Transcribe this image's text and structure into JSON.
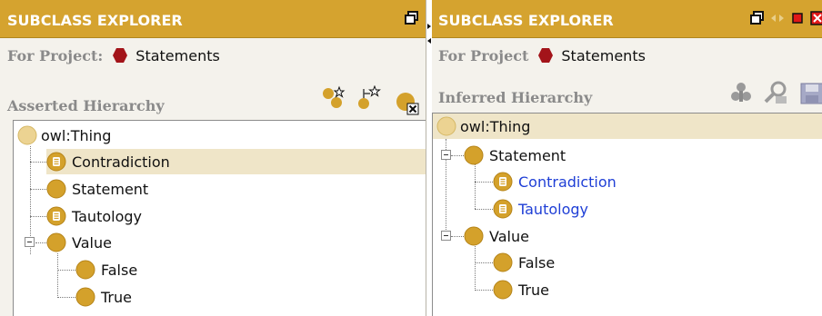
{
  "colors": {
    "title_bar": "#d5a32f",
    "panel_bg": "#f4f2ec",
    "class_icon": "#d4a12b",
    "thing_icon": "#ecd392",
    "selection_bg": "#efe5c8",
    "inferred_text": "#1f3fd6",
    "project_icon": "#a3141a"
  },
  "left": {
    "title": "SUBCLASS EXPLORER",
    "project_label": "For Project:",
    "project_name": "Statements",
    "hierarchy_label": "Asserted Hierarchy",
    "toolbar_icons": [
      "add-subclass-icon",
      "add-sibling-class-icon",
      "delete-class-icon"
    ],
    "window_icons": [
      "maximize-window-icon"
    ],
    "tree": [
      {
        "label": "owl:Thing",
        "icon": "owl-thing-icon",
        "depth": 0
      },
      {
        "label": "Contradiction",
        "icon": "defined-class-icon",
        "depth": 1,
        "selected": true
      },
      {
        "label": "Statement",
        "icon": "class-icon",
        "depth": 1
      },
      {
        "label": "Tautology",
        "icon": "defined-class-icon",
        "depth": 1
      },
      {
        "label": "Value",
        "icon": "class-icon",
        "depth": 1,
        "expanded": true
      },
      {
        "label": "False",
        "icon": "class-icon",
        "depth": 2
      },
      {
        "label": "True",
        "icon": "class-icon",
        "depth": 2
      }
    ]
  },
  "right": {
    "title": "SUBCLASS EXPLORER",
    "project_label": "For Project",
    "project_name": "Statements",
    "hierarchy_label": "Inferred Hierarchy",
    "toolbar_icons": [
      "classify-icon",
      "find-class-icon",
      "save-icon"
    ],
    "window_icons": [
      "maximize-window-icon",
      "arrows-icon",
      "minimize-icon",
      "close-icon"
    ],
    "tree": [
      {
        "label": "owl:Thing",
        "icon": "owl-thing-icon",
        "depth": 0,
        "selected": true
      },
      {
        "label": "Statement",
        "icon": "class-icon",
        "depth": 1,
        "expanded": true
      },
      {
        "label": "Contradiction",
        "icon": "defined-class-icon",
        "depth": 2,
        "inferred": true
      },
      {
        "label": "Tautology",
        "icon": "defined-class-icon",
        "depth": 2,
        "inferred": true
      },
      {
        "label": "Value",
        "icon": "class-icon",
        "depth": 1,
        "expanded": true
      },
      {
        "label": "False",
        "icon": "class-icon",
        "depth": 2
      },
      {
        "label": "True",
        "icon": "class-icon",
        "depth": 2
      }
    ]
  }
}
